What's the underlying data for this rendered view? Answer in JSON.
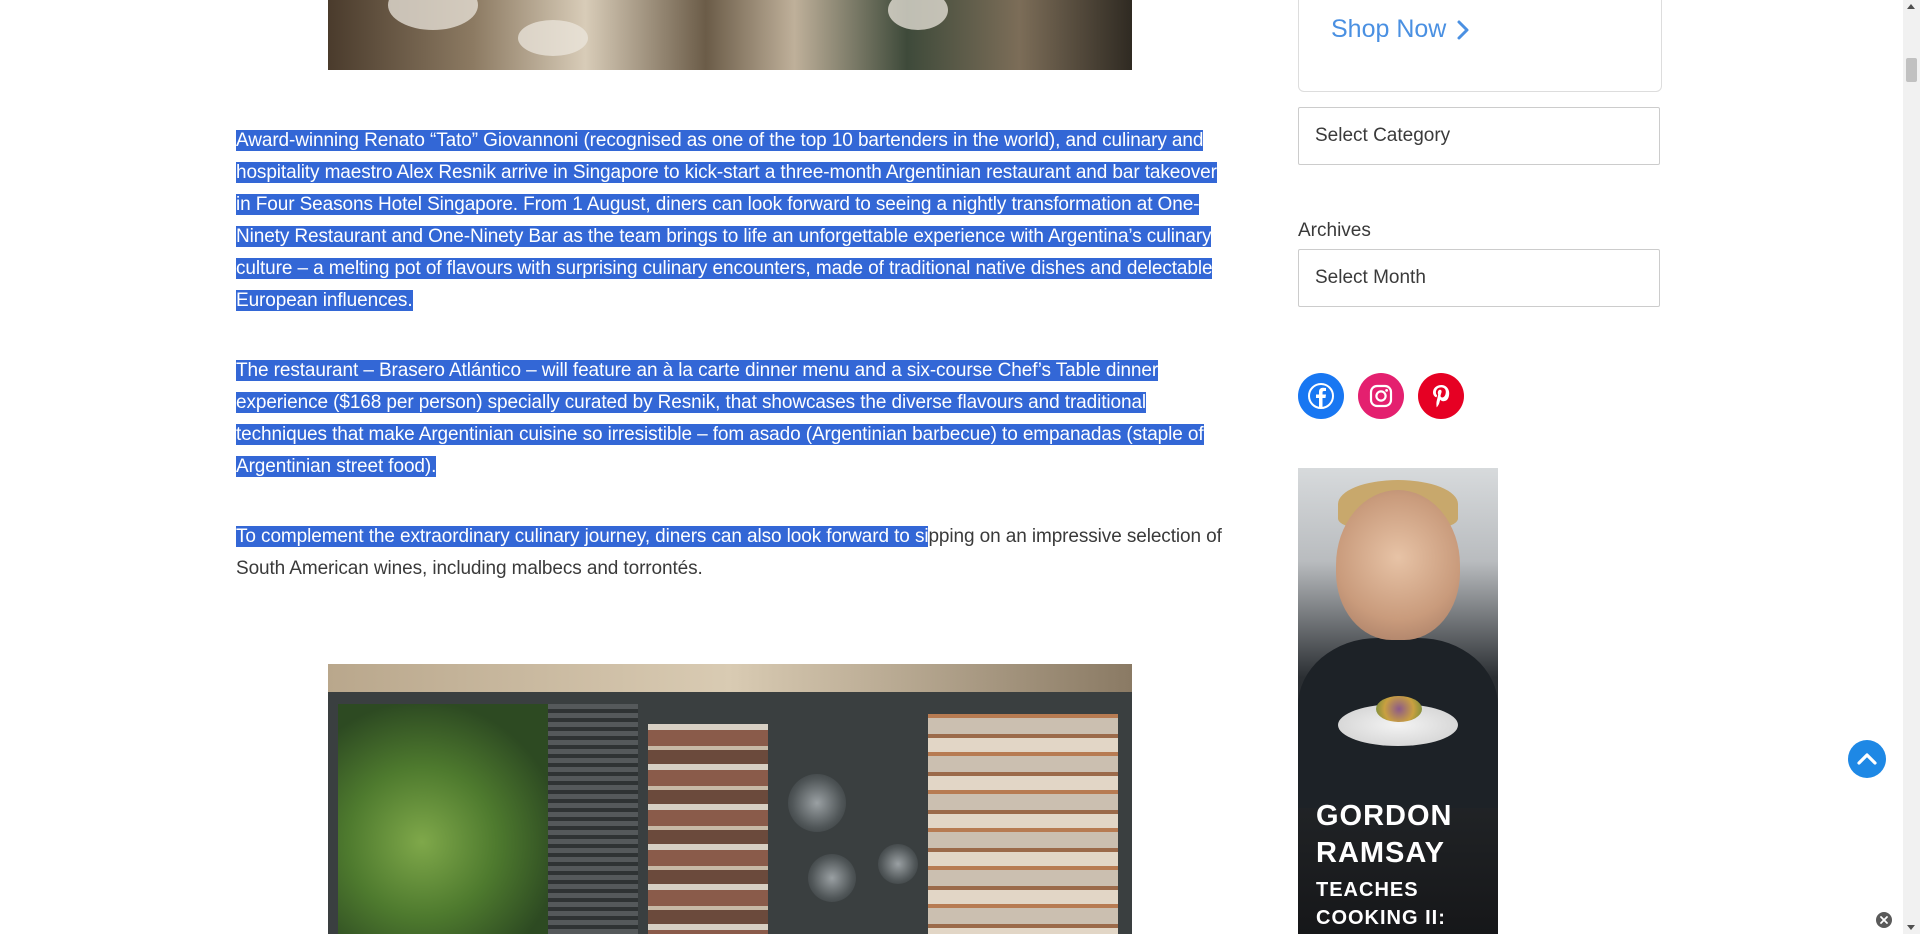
{
  "article": {
    "paragraph1": "Award-winning Renato “Tato” Giovannoni (recognised as one of the top 10 bartenders in the world), and culinary and hospitality maestro Alex Resnik arrive in Singapore to kick-start a three-month Argentinian restaurant and bar takeover in Four Seasons Hotel Singapore. From 1 August, diners can look forward to seeing a nightly transformation at One-Ninety Restaurant and One-Ninety Bar as the team brings to life an unforgettable experience with Argentina’s culinary culture – a melting pot of flavours with surprising culinary encounters, made of traditional native dishes and delectable European influences.",
    "paragraph2": "The restaurant – Brasero Atlántico – will feature an à la carte dinner menu and a six-course Chef’s Table dinner experience ($168 per person) specially curated by Resnik, that showcases the diverse flavours and traditional techniques that make Argentinian cuisine so irresistible – fom asado (Argentinian barbecue) to empanadas (staple of Argentinian street food).",
    "paragraph3_selected": "To complement the extraordinary culinary journey, diners can also look forward to si",
    "paragraph3_rest": "pping on an impressive selection of South American wines, including malbecs and torrontés."
  },
  "sidebar": {
    "shop_now_label": "Shop Now",
    "category_select": "Select Category",
    "archives_label": "Archives",
    "month_select": "Select Month",
    "social": [
      "facebook-icon",
      "instagram-icon",
      "pinterest-icon"
    ],
    "ad": {
      "title_line1": "GORDON",
      "title_line2": "RAMSAY",
      "subtitle_line1": "TEACHES",
      "subtitle_line2": "COOKING II:"
    }
  },
  "colors": {
    "selection": "#3367d6",
    "link": "#4a90e2",
    "facebook": "#1877f2",
    "instagram": "#e4206f",
    "pinterest": "#e60023",
    "scroll_top_button": "#1e88e5"
  }
}
